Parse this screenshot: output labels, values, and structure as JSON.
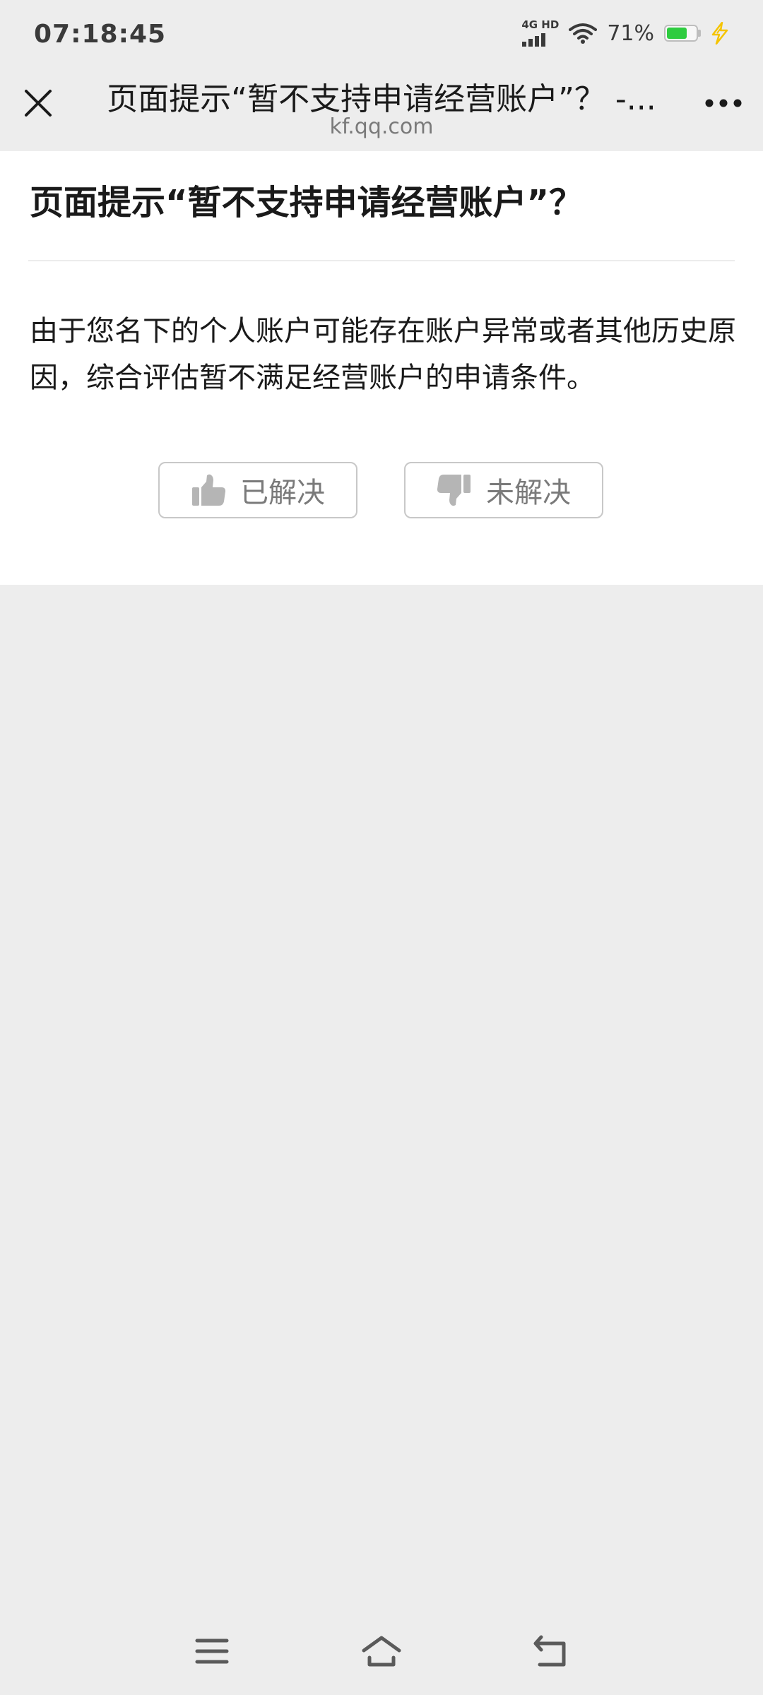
{
  "status_bar": {
    "time": "07:18:45",
    "network_label": "4G HD",
    "battery_percent_text": "71%",
    "battery_level": 0.71,
    "battery_color": "#2ecc40",
    "charging_color": "#f5c400",
    "icons": [
      "signal-icon",
      "wifi-icon",
      "battery-icon",
      "charging-icon"
    ]
  },
  "nav_bar": {
    "title": "页面提示“暂不支持申请经营账户”？ -...",
    "subtitle": "kf.qq.com",
    "icons": [
      "close-icon",
      "more-icon"
    ]
  },
  "article": {
    "question": "页面提示“暂不支持申请经营账户”？",
    "answer": "由于您名下的个人账户可能存在账户异常或者其他历史原因，综合评估暂不满足经营账户的申请条件。",
    "feedback": {
      "solved_label": "已解决",
      "unsolved_label": "未解决",
      "icons": [
        "thumbs-up-icon",
        "thumbs-down-icon"
      ]
    }
  },
  "system_nav": {
    "icons": [
      "menu-icon",
      "home-icon",
      "back-icon"
    ]
  },
  "colors": {
    "page_background": "#ededed",
    "card_background": "#ffffff",
    "text_primary": "#1a1a1a",
    "text_secondary": "#7a7a7a",
    "button_border": "#c8c8c8"
  }
}
